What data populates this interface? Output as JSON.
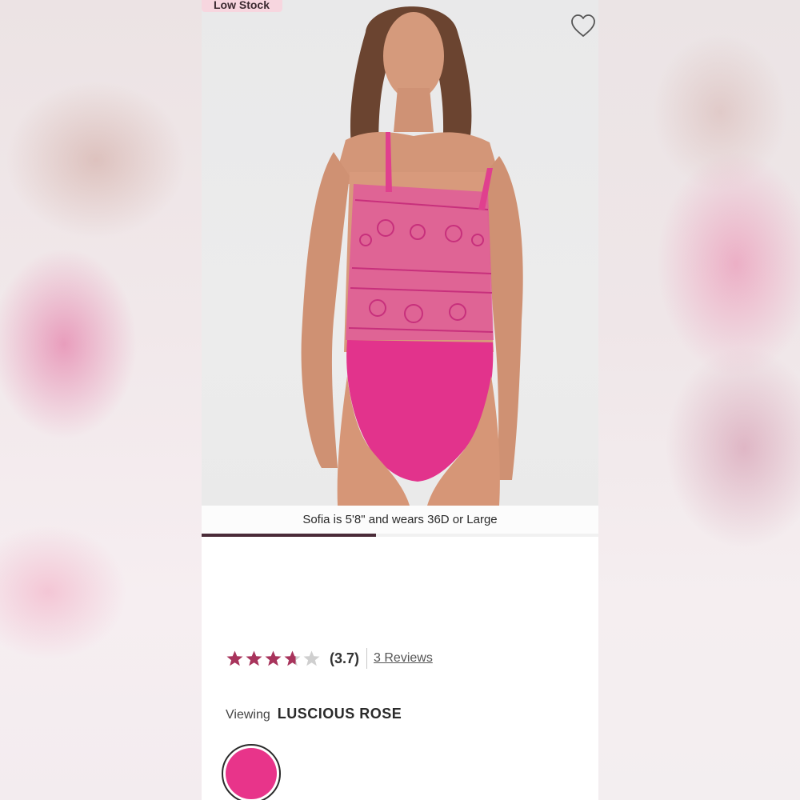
{
  "hero": {
    "badge": "Low Stock",
    "caption": "Sofia  is 5'8\" and wears 36D or Large",
    "carousel_progress": 0.44
  },
  "rating": {
    "value": 3.7,
    "score_label": "(3.7)",
    "max_stars": 5,
    "reviews_label": "3 Reviews"
  },
  "viewing": {
    "label": "Viewing",
    "color_name": "LUSCIOUS ROSE"
  },
  "colors": {
    "accent": "#e8348a",
    "star_filled": "#a8345c",
    "star_empty": "#cfcfcf",
    "badge_bg": "#f7d6df",
    "progress": "#4a2b38"
  },
  "icons": {
    "favorite": "heart-outline-icon",
    "rating": "star-icon"
  }
}
